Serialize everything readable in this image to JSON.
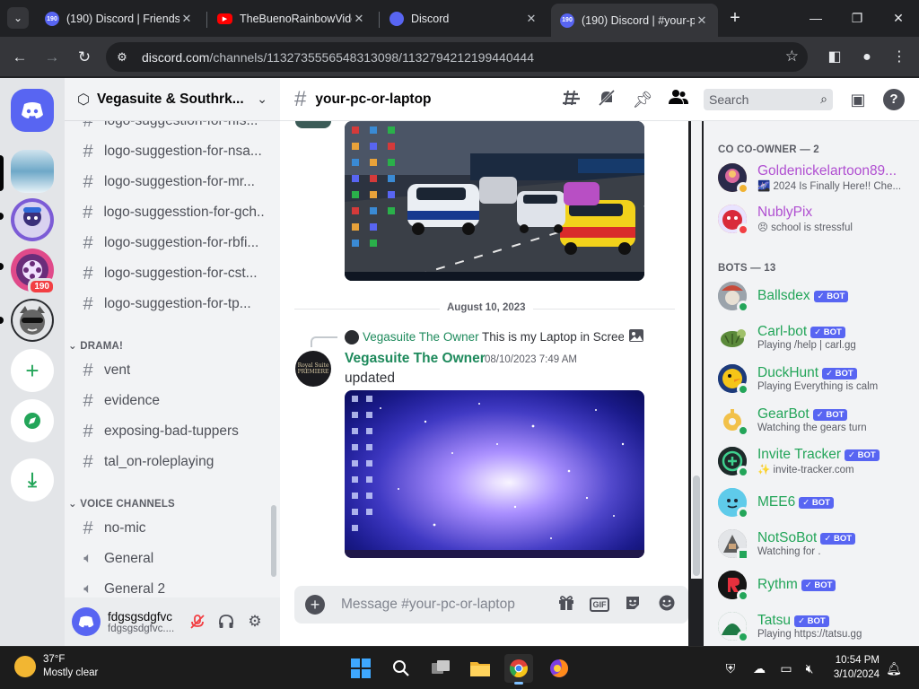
{
  "browser": {
    "tabs": [
      {
        "title": "(190) Discord | Friends",
        "badge": "190"
      },
      {
        "title": "TheBuenoRainbowVide",
        "badge": ""
      },
      {
        "title": "Discord",
        "badge": ""
      },
      {
        "title": "(190) Discord | #your-p",
        "badge": "190"
      }
    ],
    "url_host": "discord.com",
    "url_path": "/channels/1132735556548313098/1132794212199440444"
  },
  "servers": {
    "main_badge": "190"
  },
  "guild": {
    "name": "Vegasuite & Southrk...",
    "channels_top": [
      "logo-suggestion-for-nfs...",
      "logo-suggestion-for-nsa...",
      "logo-suggestion-for-mr...",
      "logo-suggesstion-for-gch...",
      "logo-suggestion-for-rbfi...",
      "logo-suggestion-for-cst...",
      "logo-suggestion-for-tp..."
    ],
    "category_drama": "DRAMA!",
    "channels_drama": [
      "vent",
      "evidence",
      "exposing-bad-tuppers",
      "tal_on-roleplaying"
    ],
    "category_voice": "VOICE CHANNELS",
    "voice_text_channel": "no-mic",
    "voice_channels": [
      "General",
      "General 2"
    ]
  },
  "user_panel": {
    "name": "fdgsgsdgfvc",
    "tag": "fdgsgsdgfvc...."
  },
  "channel": {
    "name": "your-pc-or-laptop",
    "search_placeholder": "Search"
  },
  "messages": {
    "date_divider": "August 10, 2023",
    "reply_author": "Vegasuite The Owner",
    "reply_text": "This is my Laptop in Screen",
    "author": "Vegasuite The Owner",
    "timestamp": "08/10/2023 7:49 AM",
    "text": "updated",
    "avatar_text": "Royal Suite PREMIERE"
  },
  "composer": {
    "placeholder": "Message #your-pc-or-laptop",
    "gif_label": "GIF"
  },
  "members": {
    "co_owner_heading": "CO CO-OWNER — 2",
    "co_owners": [
      {
        "name": "Goldenickelartoon89...",
        "activity": "🌌 2024 Is Finally Here!! Che...",
        "color": "#b04fd1"
      },
      {
        "name": "NublyPix",
        "activity": "😣 school is stressful",
        "color": "#b04fd1"
      }
    ],
    "bots_heading": "BOTS — 13",
    "bot_tag": "BOT",
    "bots": [
      {
        "name": "Ballsdex",
        "activity": ""
      },
      {
        "name": "Carl-bot",
        "activity": "Playing /help | carl.gg"
      },
      {
        "name": "DuckHunt",
        "activity": "Playing Everything is calm"
      },
      {
        "name": "GearBot",
        "activity": "Watching the gears turn"
      },
      {
        "name": "Invite Tracker",
        "activity": "✨ invite-tracker.com"
      },
      {
        "name": "MEE6",
        "activity": ""
      },
      {
        "name": "NotSoBot",
        "activity": "Watching for ."
      },
      {
        "name": "Rythm",
        "activity": ""
      },
      {
        "name": "Tatsu",
        "activity": "Playing https://tatsu.gg"
      }
    ],
    "bot_color": "#23a559"
  },
  "taskbar": {
    "temperature": "37°F",
    "weather": "Mostly clear",
    "time": "10:54 PM",
    "date": "3/10/2024"
  },
  "colors": {
    "blurple": "#5865f2",
    "online": "#23a559",
    "dnd": "#f23f43",
    "idle": "#f0b232"
  }
}
